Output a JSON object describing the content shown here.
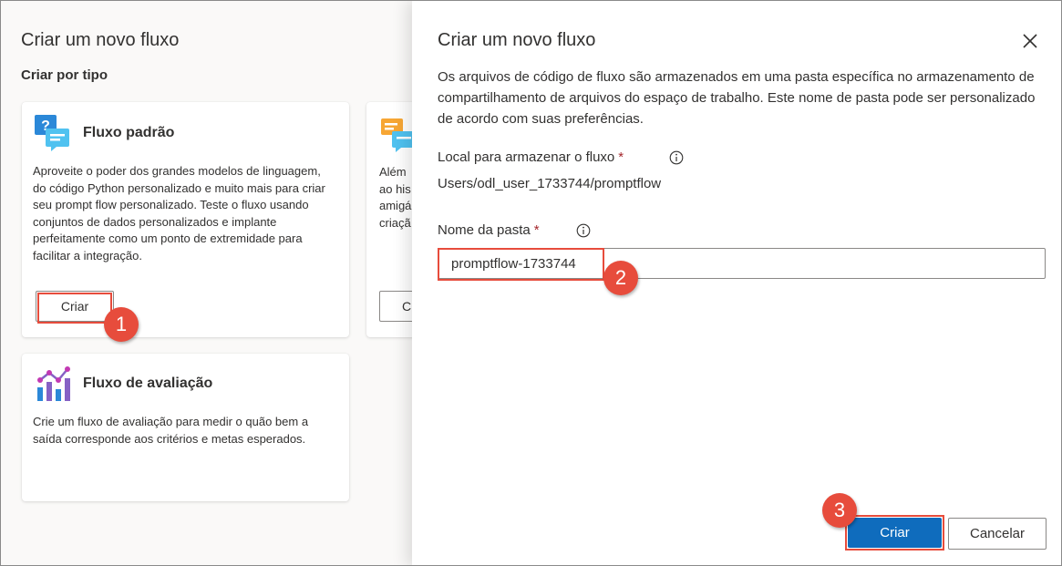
{
  "background": {
    "title": "Criar um novo fluxo",
    "subtitle": "Criar por tipo",
    "cards": [
      {
        "name": "Fluxo padrão",
        "icon": "chat-question-icon",
        "description": "Aproveite o poder dos grandes modelos de linguagem, do código Python personalizado e muito mais para criar seu prompt flow personalizado. Teste o fluxo usando conjuntos de dados personalizados e implante perfeitamente como um ponto de extremidade para facilitar a integração.",
        "button_label": "Criar"
      },
      {
        "name": "Fluxo de avaliação",
        "icon": "chart-evaluation-icon",
        "description": "Crie um fluxo de avaliação para medir o quão bem a saída corresponde aos critérios e metas esperados."
      },
      {
        "icon": "chat-bubbles-icon",
        "description_lines": [
          "Além",
          "ao his",
          "amigá",
          "criaçã"
        ],
        "button_label": "C"
      }
    ]
  },
  "dialog": {
    "title": "Criar um novo fluxo",
    "close_icon": "close-icon",
    "description": "Os arquivos de código de fluxo são armazenados em uma pasta específica no armazenamento de compartilhamento de arquivos do espaço de trabalho. Este nome de pasta pode ser personalizado de acordo com suas preferências.",
    "storage_label": "Local para armazenar o fluxo",
    "storage_value": "Users/odl_user_1733744/promptflow",
    "folder_label": "Nome da pasta",
    "required_marker": "*",
    "folder_value": "promptflow-1733744",
    "create_label": "Criar",
    "cancel_label": "Cancelar"
  },
  "annotations": [
    "1",
    "2",
    "3"
  ],
  "colors": {
    "primary": "#0f6cbd",
    "highlight": "#e74c3c",
    "required": "#a4262c"
  }
}
